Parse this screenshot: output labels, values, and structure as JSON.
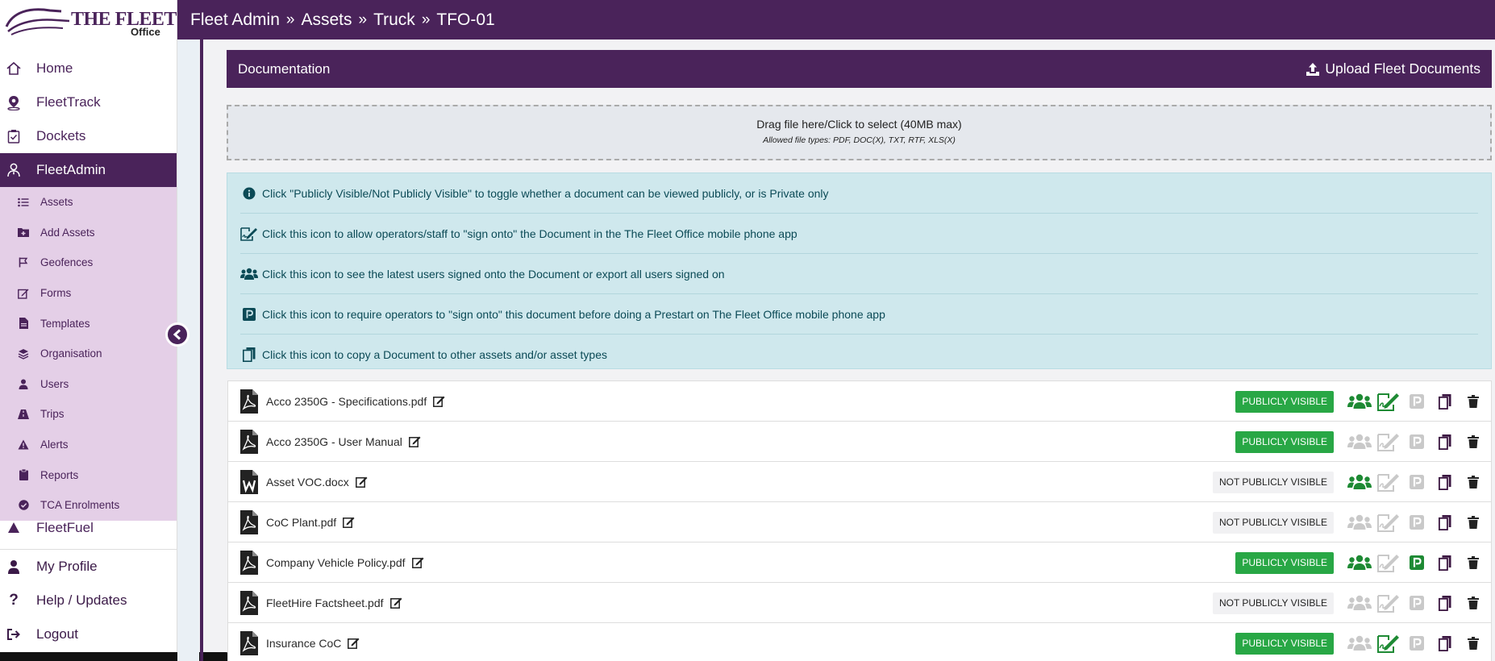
{
  "colors": {
    "brand": "#4a235a",
    "brand_light": "#e4cfe7",
    "success": "#28a745",
    "icon_active_green": "#1e8a34",
    "icon_inactive": "#c9c9c9",
    "info_bg": "#cfe8ed"
  },
  "logo": {
    "title": "THE FLEET",
    "subtitle": "Office"
  },
  "sidebar": {
    "main_items": [
      {
        "label": "Home",
        "icon": "home-icon"
      },
      {
        "label": "FleetTrack",
        "icon": "location-pin-icon"
      },
      {
        "label": "Dockets",
        "icon": "clipboard-check-icon"
      },
      {
        "label": "FleetAdmin",
        "icon": "user-tie-icon",
        "active": true
      }
    ],
    "sub_items": [
      {
        "label": "Assets",
        "icon": "list-icon"
      },
      {
        "label": "Add Assets",
        "icon": "folder-plus-icon"
      },
      {
        "label": "Geofences",
        "icon": "flag-icon"
      },
      {
        "label": "Forms",
        "icon": "edit-icon"
      },
      {
        "label": "Templates",
        "icon": "file-icon"
      },
      {
        "label": "Organisation",
        "icon": "layers-icon"
      },
      {
        "label": "Users",
        "icon": "user-icon"
      },
      {
        "label": "Trips",
        "icon": "road-icon"
      },
      {
        "label": "Alerts",
        "icon": "warning-icon"
      },
      {
        "label": "Reports",
        "icon": "clipboard-icon"
      },
      {
        "label": "TCA Enrolments",
        "icon": "check-circle-icon"
      }
    ],
    "partial_item": {
      "label": "FleetFuel",
      "icon": "fuel-icon"
    },
    "bottom_items": [
      {
        "label": "My Profile",
        "icon": "user-icon"
      },
      {
        "label": "Help / Updates",
        "icon": "question-icon"
      },
      {
        "label": "Logout",
        "icon": "logout-icon"
      }
    ]
  },
  "breadcrumb": {
    "items": [
      "Fleet Admin",
      "Assets",
      "Truck",
      "TFO-01"
    ],
    "separator": "»"
  },
  "documentation": {
    "title": "Documentation",
    "upload_label": "Upload Fleet Documents",
    "dropzone": {
      "main": "Drag file here/Click to select (40MB max)",
      "sub": "Allowed file types: PDF, DOC(X), TXT, RTF, XLS(X)"
    },
    "info": [
      {
        "icon": "info-circle-icon",
        "text": "Click \"Publicly Visible/Not Publicly Visible\" to toggle whether a document can be viewed publicly, or is Private only"
      },
      {
        "icon": "signature-icon",
        "text": "Click this icon to allow operators/staff to \"sign onto\" the Document in the The Fleet Office mobile phone app"
      },
      {
        "icon": "users-icon",
        "text": "Click this icon to see the latest users signed onto the Document or export all users signed on"
      },
      {
        "icon": "parking-icon",
        "text": "Click this icon to require operators to \"sign onto\" this document before doing a Prestart on The Fleet Office mobile phone app"
      },
      {
        "icon": "copy-icon",
        "text": "Click this icon to copy a Document to other assets and/or asset types"
      }
    ],
    "documents": [
      {
        "name": "Acco 2350G - Specifications.pdf",
        "type": "pdf",
        "visibility": "PUBLICLY VISIBLE",
        "public": true,
        "users_active": true,
        "sign_active": true,
        "prestart_active": false
      },
      {
        "name": "Acco 2350G - User Manual",
        "type": "pdf",
        "visibility": "PUBLICLY VISIBLE",
        "public": true,
        "users_active": false,
        "sign_active": false,
        "prestart_active": false
      },
      {
        "name": "Asset VOC.docx",
        "type": "word",
        "visibility": "NOT PUBLICLY VISIBLE",
        "public": false,
        "users_active": true,
        "sign_active": false,
        "prestart_active": false
      },
      {
        "name": "CoC Plant.pdf",
        "type": "pdf",
        "visibility": "NOT PUBLICLY VISIBLE",
        "public": false,
        "users_active": false,
        "sign_active": false,
        "prestart_active": false
      },
      {
        "name": "Company Vehicle Policy.pdf",
        "type": "pdf",
        "visibility": "PUBLICLY VISIBLE",
        "public": true,
        "users_active": true,
        "sign_active": false,
        "prestart_active": true
      },
      {
        "name": "FleetHire Factsheet.pdf",
        "type": "pdf",
        "visibility": "NOT PUBLICLY VISIBLE",
        "public": false,
        "users_active": false,
        "sign_active": false,
        "prestart_active": false
      },
      {
        "name": "Insurance CoC",
        "type": "pdf",
        "visibility": "PUBLICLY VISIBLE",
        "public": true,
        "users_active": false,
        "sign_active": true,
        "prestart_active": false
      }
    ]
  }
}
